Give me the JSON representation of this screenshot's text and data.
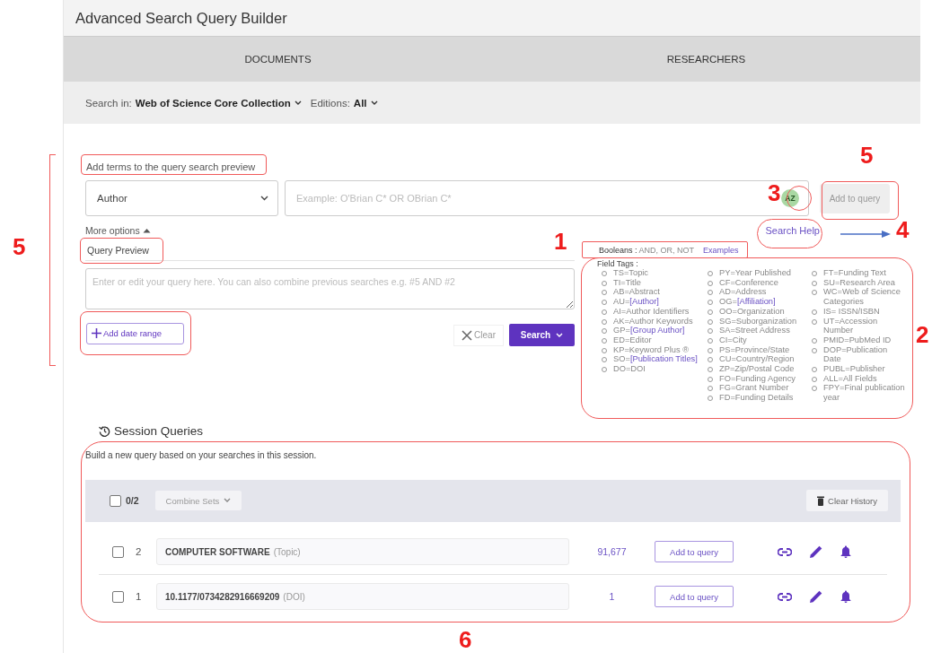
{
  "title": "Advanced Search Query Builder",
  "tabs": [
    {
      "label": "DOCUMENTS"
    },
    {
      "label": "RESEARCHERS"
    }
  ],
  "search_in": {
    "label": "Search in:",
    "value": "Web of Science Core Collection",
    "editions_label": "Editions:",
    "editions_value": "All"
  },
  "add_terms": {
    "label": "Add terms to the query search preview",
    "field": "Author",
    "placeholder": "Example: O'Brian C* OR OBrian C*",
    "badge": "AZ",
    "add_button": "Add to query",
    "more_options": "More options",
    "search_help": "Search Help"
  },
  "query_preview": {
    "label": "Query Preview",
    "placeholder": "Enter or edit your query here. You can also combine previous searches e.g. #5 AND #2",
    "date_button": "Add date range",
    "clear_button": "Clear",
    "search_button": "Search"
  },
  "help": {
    "booleans_label": "Booleans :",
    "booleans": "AND, OR, NOT",
    "examples": "Examples",
    "field_tags_label": "Field Tags :",
    "columns": [
      [
        {
          "text": "TS=Topic"
        },
        {
          "text": "TI=Title"
        },
        {
          "text": "AB=Abstract"
        },
        {
          "text": "AU=",
          "link": "[Author]"
        },
        {
          "text": "AI=Author Identifiers"
        },
        {
          "text": "AK=Author Keywords"
        },
        {
          "text": "GP=",
          "link": "[Group Author]"
        },
        {
          "text": "ED=Editor"
        },
        {
          "text": "KP=Keyword Plus ®"
        },
        {
          "text": "SO=",
          "link": "[Publication Titles]"
        },
        {
          "text": "DO=DOI"
        }
      ],
      [
        {
          "text": "PY=Year Published"
        },
        {
          "text": "CF=Conference"
        },
        {
          "text": "AD=Address"
        },
        {
          "text": "OG=",
          "link": "[Affiliation]"
        },
        {
          "text": "OO=Organization"
        },
        {
          "text": "SG=Suborganization"
        },
        {
          "text": "SA=Street Address"
        },
        {
          "text": "CI=City"
        },
        {
          "text": "PS=Province/State"
        },
        {
          "text": "CU=Country/Region"
        },
        {
          "text": "ZP=Zip/Postal Code"
        },
        {
          "text": "FO=Funding Agency"
        },
        {
          "text": "FG=Grant Number"
        },
        {
          "text": "FD=Funding Details"
        }
      ],
      [
        {
          "text": "FT=Funding Text"
        },
        {
          "text": "SU=Research Area"
        },
        {
          "text": "WC=Web of Science Categories"
        },
        {
          "text": "IS= ISSN/ISBN"
        },
        {
          "text": "UT=Accession Number"
        },
        {
          "text": "PMID=PubMed ID"
        },
        {
          "text": "DOP=Publication Date"
        },
        {
          "text": "PUBL=Publisher"
        },
        {
          "text": "ALL=All Fields"
        },
        {
          "text": "FPY=Final publication year"
        }
      ]
    ]
  },
  "session": {
    "title": "Session Queries",
    "description": "Build a new query based on your searches in this session.",
    "count": "0/2",
    "checked": false,
    "combine": "Combine Sets",
    "clear_history": "Clear History",
    "rows": [
      {
        "number": "2",
        "query": "COMPUTER SOFTWARE",
        "field": "(Topic)",
        "results": "91,677",
        "button": "Add to query",
        "checked": false
      },
      {
        "number": "1",
        "query": "10.1177/0734282916669209",
        "field": "(DOI)",
        "results": "1",
        "button": "Add to query",
        "checked": false
      }
    ]
  },
  "annotations": [
    {
      "label": "5"
    },
    {
      "label": "5"
    },
    {
      "label": "3"
    },
    {
      "label": "1"
    },
    {
      "label": "4"
    },
    {
      "label": "2"
    },
    {
      "label": "6"
    }
  ]
}
